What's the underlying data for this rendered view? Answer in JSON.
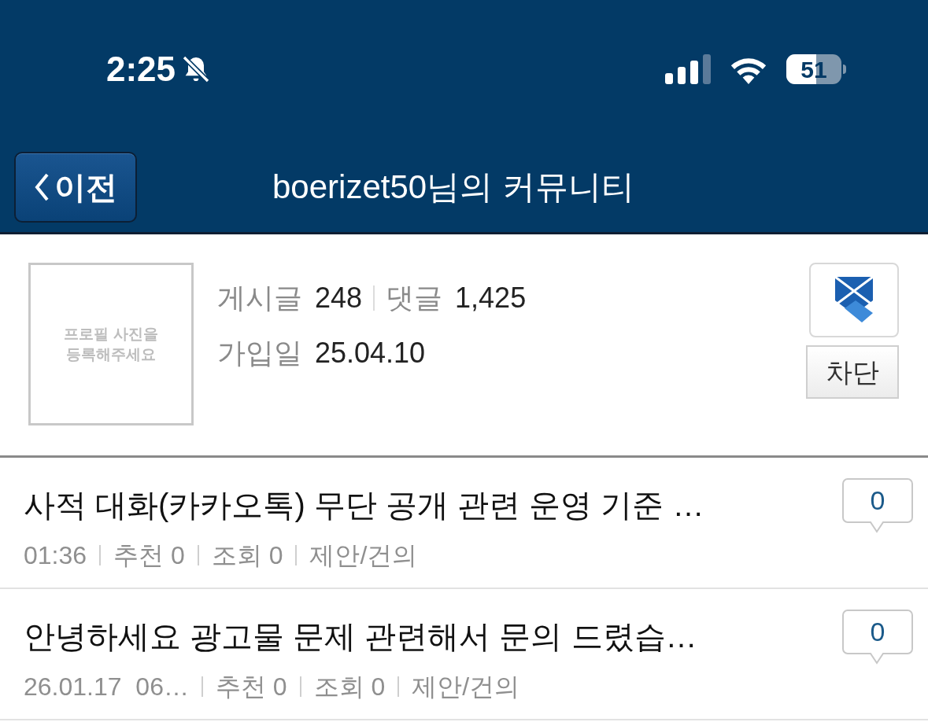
{
  "status_bar": {
    "time": "2:25",
    "battery": "51"
  },
  "nav": {
    "back": "이전",
    "title": "boerizet50님의 커뮤니티"
  },
  "profile": {
    "photo_placeholder": "프로필 사진을\n등록해주세요",
    "stats": [
      {
        "label": "게시글",
        "value": "248"
      },
      {
        "label": "댓글",
        "value": "1,425"
      }
    ],
    "joined": {
      "label": "가입일",
      "value": "25.04.10"
    },
    "block_button": "차단"
  },
  "posts": [
    {
      "title": "사적 대화(카카오톡) 무단 공개 관련 운영 기준 …",
      "date": "01:36",
      "recommend": "추천 0",
      "views": "조회 0",
      "category": "제안/건의",
      "comments": "0"
    },
    {
      "title": "안녕하세요 광고물 문제 관련해서 문의 드렸습…",
      "date": "26.01.17  06…",
      "recommend": "추천 0",
      "views": "조회 0",
      "category": "제안/건의",
      "comments": "0"
    }
  ]
}
